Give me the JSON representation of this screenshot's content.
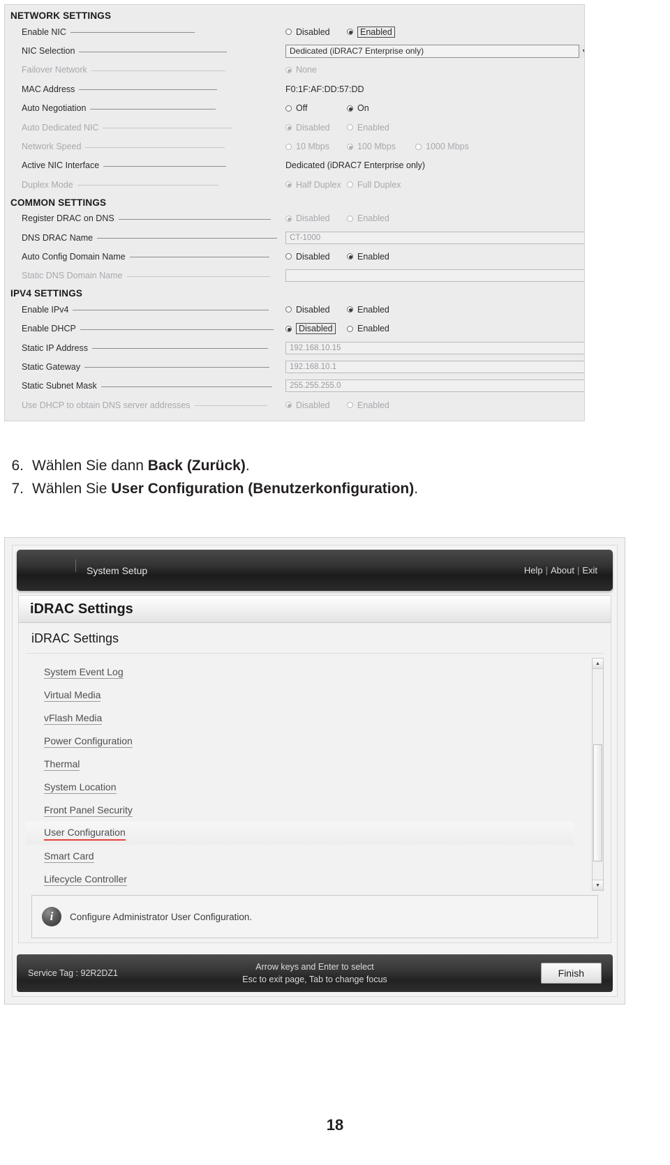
{
  "network_screenshot": {
    "sections": [
      {
        "heading": "NETWORK SETTINGS",
        "rows": [
          {
            "label": "Enable NIC",
            "dim": false,
            "leader": 178,
            "type": "radios",
            "options": [
              {
                "text": "Disabled",
                "selected": false,
                "focus": false
              },
              {
                "text": "Enabled",
                "selected": true,
                "focus": true
              }
            ]
          },
          {
            "label": "NIC Selection",
            "dim": false,
            "leader": 212,
            "type": "combo",
            "value": "Dedicated (iDRAC7 Enterprise only)"
          },
          {
            "label": "Failover Network",
            "dim": true,
            "leader": 192,
            "type": "radios",
            "options": [
              {
                "text": "None",
                "selected": true,
                "focus": false
              }
            ]
          },
          {
            "label": "MAC Address",
            "dim": false,
            "leader": 198,
            "type": "text",
            "value": "F0:1F:AF:DD:57:DD"
          },
          {
            "label": "Auto Negotiation",
            "dim": false,
            "leader": 180,
            "type": "radios",
            "options": [
              {
                "text": "Off",
                "selected": false,
                "focus": false
              },
              {
                "text": "On",
                "selected": true,
                "focus": false
              }
            ]
          },
          {
            "label": "Auto Dedicated NIC",
            "dim": true,
            "leader": 185,
            "type": "radios",
            "options": [
              {
                "text": "Disabled",
                "selected": true,
                "focus": false
              },
              {
                "text": "Enabled",
                "selected": false,
                "focus": false
              }
            ]
          },
          {
            "label": "Network Speed",
            "dim": true,
            "leader": 200,
            "type": "radios",
            "options": [
              {
                "text": "10 Mbps",
                "selected": false,
                "focus": false
              },
              {
                "text": "100 Mbps",
                "selected": true,
                "focus": false
              },
              {
                "text": "1000 Mbps",
                "selected": false,
                "focus": false
              }
            ]
          },
          {
            "label": "Active NIC Interface",
            "dim": false,
            "leader": 176,
            "type": "text",
            "value": "Dedicated (iDRAC7 Enterprise only)"
          },
          {
            "label": "Duplex Mode",
            "dim": true,
            "leader": 202,
            "type": "radios",
            "options": [
              {
                "text": "Half Duplex",
                "selected": true,
                "focus": false
              },
              {
                "text": "Full Duplex",
                "selected": false,
                "focus": false
              }
            ]
          }
        ]
      },
      {
        "heading": "COMMON SETTINGS",
        "rows": [
          {
            "label": "Register DRAC on DNS",
            "dim": false,
            "leader": 218,
            "type": "radios",
            "options": [
              {
                "text": "Disabled",
                "selected": true,
                "focus": false
              },
              {
                "text": "Enabled",
                "selected": false,
                "focus": false
              }
            ],
            "dimopts": true
          },
          {
            "label": "DNS DRAC Name",
            "dim": false,
            "leader": 258,
            "type": "field",
            "value": "CT-1000"
          },
          {
            "label": "Auto Config Domain Name",
            "dim": false,
            "leader": 200,
            "type": "radios",
            "options": [
              {
                "text": "Disabled",
                "selected": false,
                "focus": false
              },
              {
                "text": "Enabled",
                "selected": true,
                "focus": false
              }
            ]
          },
          {
            "label": "Static DNS Domain Name",
            "dim": true,
            "leader": 205,
            "type": "field",
            "value": ""
          }
        ]
      },
      {
        "heading": "IPV4 SETTINGS",
        "rows": [
          {
            "label": "Enable IPv4",
            "dim": false,
            "leader": 281,
            "type": "radios",
            "options": [
              {
                "text": "Disabled",
                "selected": false,
                "focus": false
              },
              {
                "text": "Enabled",
                "selected": true,
                "focus": false
              }
            ]
          },
          {
            "label": "Enable DHCP",
            "dim": false,
            "leader": 277,
            "type": "radios",
            "options": [
              {
                "text": "Disabled",
                "selected": true,
                "focus": true
              },
              {
                "text": "Enabled",
                "selected": false,
                "focus": false
              }
            ]
          },
          {
            "label": "Static IP Address",
            "dim": false,
            "leader": 252,
            "type": "field",
            "value": "192.168.10.15"
          },
          {
            "label": "Static Gateway",
            "dim": false,
            "leader": 265,
            "type": "field",
            "value": "192.168.10.1"
          },
          {
            "label": "Static Subnet Mask",
            "dim": false,
            "leader": 245,
            "type": "field",
            "value": "255.255.255.0"
          },
          {
            "label": "Use DHCP to obtain DNS server addresses",
            "dim": true,
            "leader": 104,
            "type": "radios",
            "options": [
              {
                "text": "Disabled",
                "selected": true,
                "focus": false
              },
              {
                "text": "Enabled",
                "selected": false,
                "focus": false
              }
            ]
          }
        ]
      }
    ]
  },
  "steps": [
    {
      "num": "6.",
      "pre": "Wählen Sie dann ",
      "bold": "Back (Zurück)",
      "post": "."
    },
    {
      "num": "7.",
      "pre": "Wählen Sie ",
      "bold": "User Configuration (Benutzerkonfiguration)",
      "post": "."
    }
  ],
  "idrac_screenshot": {
    "titlebar": {
      "system_setup": "System Setup",
      "help": "Help",
      "about": "About",
      "exit": "Exit",
      "separator": "|"
    },
    "page_tab_title": "iDRAC Settings",
    "page_heading": "iDRAC Settings",
    "menu_items": [
      {
        "label": "System Event Log",
        "selected": false
      },
      {
        "label": "Virtual Media",
        "selected": false
      },
      {
        "label": "vFlash Media",
        "selected": false
      },
      {
        "label": "Power Configuration",
        "selected": false
      },
      {
        "label": "Thermal",
        "selected": false
      },
      {
        "label": "System Location",
        "selected": false
      },
      {
        "label": "Front Panel Security",
        "selected": false
      },
      {
        "label": "User Configuration",
        "selected": true
      },
      {
        "label": "Smart Card",
        "selected": false
      },
      {
        "label": "Lifecycle Controller",
        "selected": false
      }
    ],
    "info_text": "Configure Administrator User Configuration.",
    "info_icon_glyph": "i",
    "scrollbar": {
      "up_glyph": "▲",
      "down_glyph": "▼"
    },
    "footer": {
      "service_tag": "Service Tag : 92R2DZ1",
      "hint_line1": "Arrow keys and Enter to select",
      "hint_line2": "Esc to exit page, Tab to change focus",
      "finish_label": "Finish"
    },
    "accent_color": "#e8403a"
  },
  "page_number": "18"
}
